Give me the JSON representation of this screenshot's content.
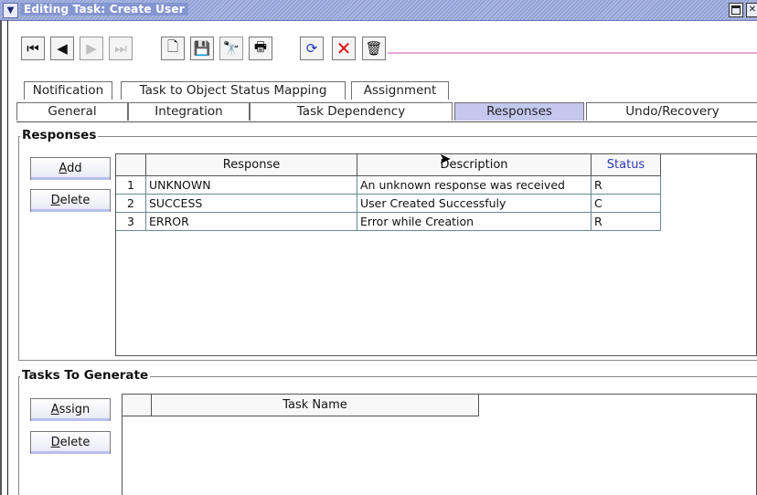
{
  "window": {
    "title": "Editing Task: Create User"
  },
  "toolbar": {
    "buttons": [
      {
        "name": "first-record-icon",
        "glyph": "⏮",
        "enabled": true
      },
      {
        "name": "previous-record-icon",
        "glyph": "◀",
        "enabled": true
      },
      {
        "name": "next-record-icon",
        "glyph": "▶",
        "enabled": false
      },
      {
        "name": "last-record-icon",
        "glyph": "⏭",
        "enabled": false
      },
      {
        "name": "new-icon",
        "glyph": "🗋",
        "enabled": true
      },
      {
        "name": "save-icon",
        "glyph": "💾",
        "enabled": true
      },
      {
        "name": "find-icon",
        "glyph": "🔭",
        "enabled": false
      },
      {
        "name": "query-icon",
        "glyph": "🖶",
        "enabled": true
      },
      {
        "name": "refresh-icon",
        "glyph": "⟳",
        "enabled": true
      },
      {
        "name": "cancel-icon",
        "glyph": "✕",
        "enabled": true
      },
      {
        "name": "delete-icon",
        "glyph": "🗑",
        "enabled": true
      }
    ]
  },
  "tabs": {
    "back_row": [
      "Notification",
      "Task to Object Status Mapping",
      "Assignment"
    ],
    "front_row": [
      "General",
      "Integration",
      "Task Dependency",
      "Responses",
      "Undo/Recovery"
    ],
    "selected": "Responses"
  },
  "responses": {
    "section_title": "Responses",
    "add_label": "Add",
    "delete_label": "Delete",
    "columns": [
      "Response",
      "Description",
      "Status"
    ],
    "rows": [
      {
        "num": "1",
        "response": "UNKNOWN",
        "description": "An unknown response was received",
        "status": "R"
      },
      {
        "num": "2",
        "response": "SUCCESS",
        "description": "User Created Successfuly",
        "status": "C"
      },
      {
        "num": "3",
        "response": "ERROR",
        "description": "Error while Creation",
        "status": "R"
      }
    ]
  },
  "tasks_to_generate": {
    "section_title": "Tasks To Generate",
    "assign_label": "Assign",
    "delete_label": "Delete",
    "columns": [
      "Task Name"
    ]
  },
  "colors": {
    "title_bar": "#8b9bd0",
    "selected_tab": "#c4c8ee",
    "status_header_text": "#2a3ab8"
  }
}
